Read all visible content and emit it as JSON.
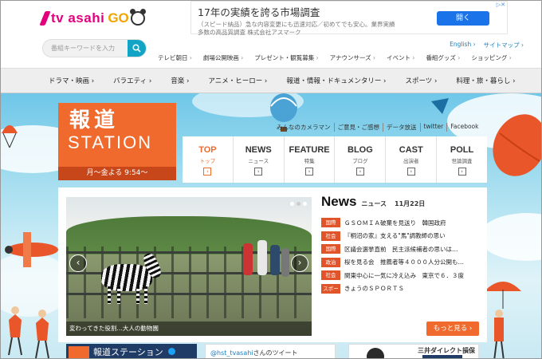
{
  "header": {
    "logo_text": "tv asahi",
    "logo_go": "GO",
    "search_placeholder": "番組キーワードを入力",
    "util_links": [
      "English ›",
      "サイトマップ ›"
    ],
    "sub_nav": [
      "テレビ朝日 ",
      "劇場公開映画",
      "プレゼント・観覧募集",
      "アナウンサーズ",
      "イベント",
      "番組グッズ",
      "ショッピング"
    ]
  },
  "ad": {
    "title": "17年の実績を誇る市場調査",
    "description": "（スピード納品）急な内容変更にも迅速対応／初めてでも安心。業界実績多数の高品質調査 株式会社アスマーク",
    "button": "開く"
  },
  "main_nav": [
    "ドラマ・映画",
    "バラエティ",
    "音楽",
    "アニメ・ヒーロー",
    "報道・情報・ドキュメンタリー",
    "スポーツ",
    "料理・旅・暮らし"
  ],
  "station": {
    "title_jp": "報道",
    "title_en": "STATION",
    "airtime": "月～金よる 9:54～"
  },
  "top_links": [
    "みんなのカメラマン",
    "ご意見・ご感想",
    "データ放送",
    "twitter",
    "Facebook"
  ],
  "tabs": [
    {
      "en": "TOP",
      "jp": "トップ",
      "active": true
    },
    {
      "en": "NEWS",
      "jp": "ニュース",
      "active": false
    },
    {
      "en": "FEATURE",
      "jp": "特集",
      "active": false
    },
    {
      "en": "BLOG",
      "jp": "ブログ",
      "active": false
    },
    {
      "en": "CAST",
      "jp": "出演者",
      "active": false
    },
    {
      "en": "POLL",
      "jp": "世論調査",
      "active": false
    }
  ],
  "slideshow": {
    "caption": "変わってきた役割…大人の動物園"
  },
  "news": {
    "title": "News",
    "subtitle": "ニュース",
    "date": "11月22日",
    "items": [
      {
        "category": "国際",
        "text": "ＧＳＯＭＩＡ破棄を見送り　韓国政府"
      },
      {
        "category": "社会",
        "text": "『桐沼の家』支える\"馬\"調教師の思い"
      },
      {
        "category": "国際",
        "text": "区議会選挙直前　民主派候補者の思いは…"
      },
      {
        "category": "政治",
        "text": "桜を見る会　推薦者等４０００人分公開も…"
      },
      {
        "category": "社会",
        "text": "関東中心に一気に冷え込み　東京で６．３度"
      },
      {
        "category": "スポーツ",
        "text": "きょうのＳＰＯＲＴＳ"
      }
    ],
    "more_label": "もっと見る ›"
  },
  "widgets": {
    "station_title": "報道ステーション",
    "twitter_handle": "@hst_tvasahi",
    "twitter_suffix": "さんのツイート",
    "ad_brand": "三井ダイレクト損保"
  },
  "colors": {
    "brand_pink": "#e3007f",
    "station_orange": "#ef6a2c",
    "category_red": "#e1542a",
    "search_teal": "#12a4c4"
  }
}
